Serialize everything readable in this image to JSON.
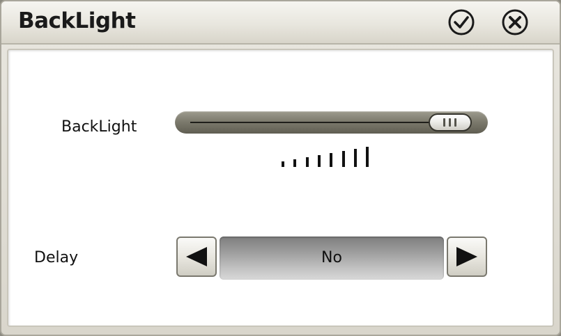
{
  "window": {
    "title": "BackLight",
    "ok_icon": "check-circle-icon",
    "close_icon": "close-circle-icon"
  },
  "backlight": {
    "label": "BackLight",
    "level": 1.0,
    "level_bars": 8
  },
  "delay": {
    "label": "Delay",
    "value": "No",
    "prev_icon": "triangle-left-icon",
    "next_icon": "triangle-right-icon"
  },
  "colors": {
    "track": "#7d7b6e",
    "title_bar": "#e8e6de",
    "value_box": "#a0a0a0"
  }
}
